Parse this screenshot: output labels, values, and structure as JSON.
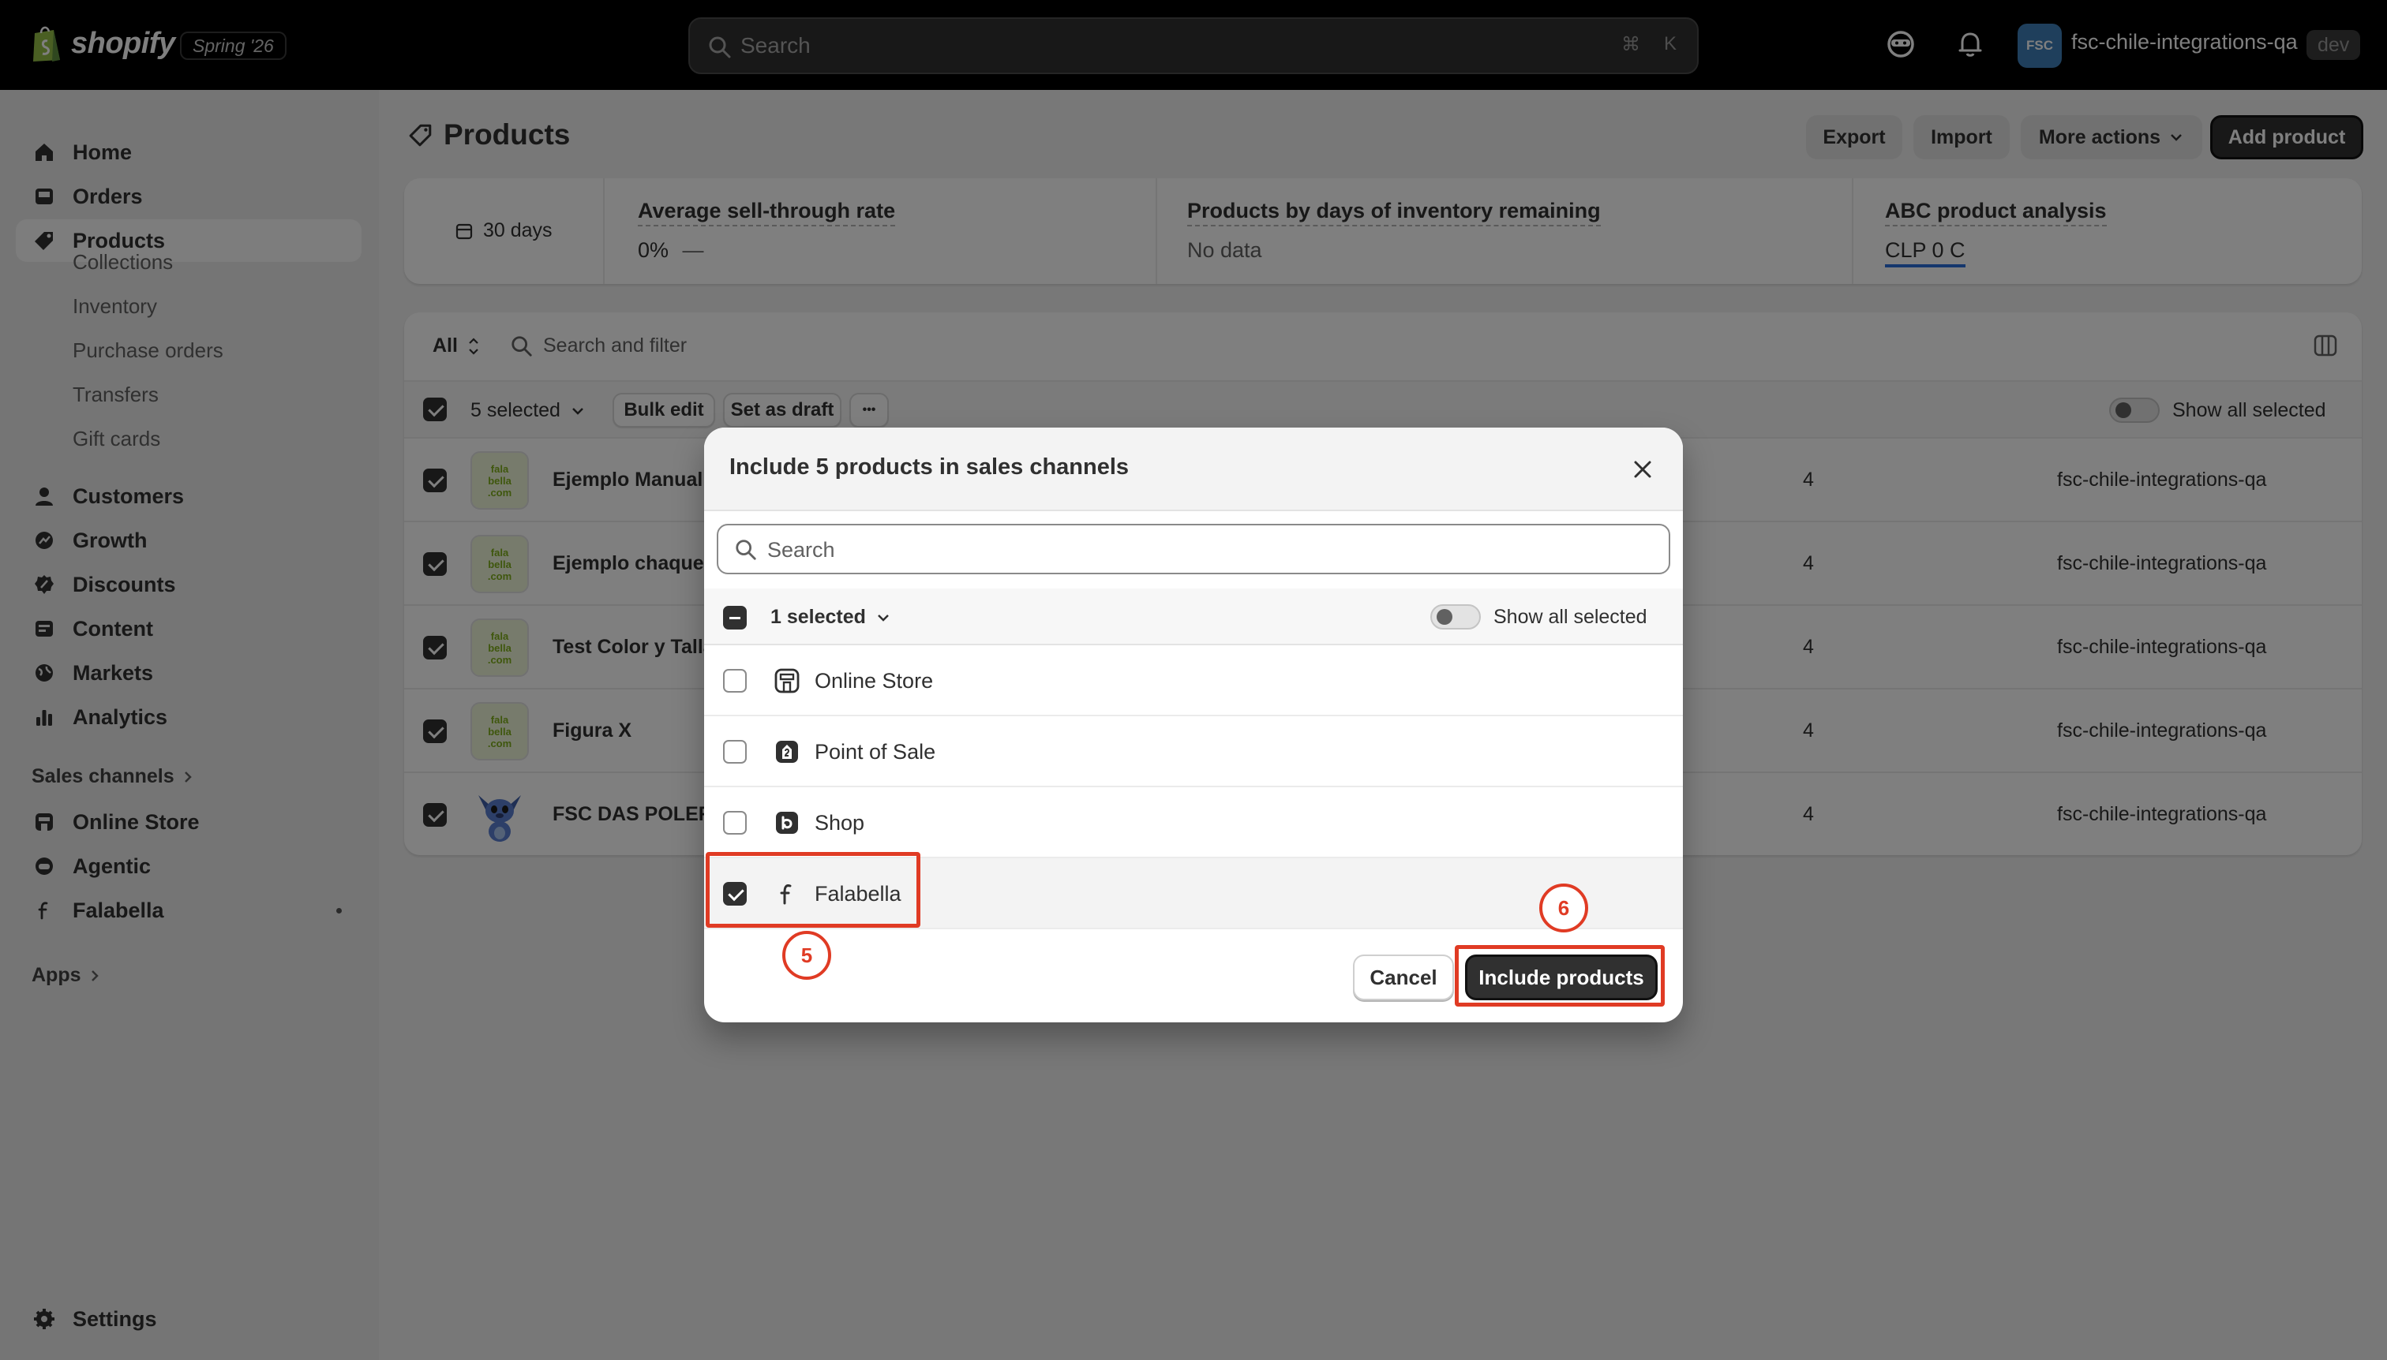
{
  "topbar": {
    "logo_text": "shopify",
    "release_badge": "Spring '26",
    "search_placeholder": "Search",
    "shortcut_cmd": "⌘",
    "shortcut_key": "K",
    "store_initials": "FSC",
    "store_name": "fsc-chile-integrations-qa",
    "env_badge": "dev"
  },
  "sidebar": {
    "items": [
      {
        "label": "Home",
        "icon": "home-icon"
      },
      {
        "label": "Orders",
        "icon": "inbox-icon"
      },
      {
        "label": "Products",
        "icon": "tag-icon",
        "active": true
      },
      {
        "label": "Customers",
        "icon": "person-icon"
      },
      {
        "label": "Growth",
        "icon": "growth-icon"
      },
      {
        "label": "Discounts",
        "icon": "discount-icon"
      },
      {
        "label": "Content",
        "icon": "content-icon"
      },
      {
        "label": "Markets",
        "icon": "globe-icon"
      },
      {
        "label": "Analytics",
        "icon": "bar-chart-icon"
      }
    ],
    "product_subitems": [
      "Collections",
      "Inventory",
      "Purchase orders",
      "Transfers",
      "Gift cards"
    ],
    "sales_channels_label": "Sales channels",
    "channels": [
      {
        "label": "Online Store",
        "icon": "store-icon"
      },
      {
        "label": "Agentic",
        "icon": "agent-icon"
      },
      {
        "label": "Falabella",
        "icon": "falabella-icon"
      }
    ],
    "apps_label": "Apps",
    "settings_label": "Settings"
  },
  "page": {
    "title": "Products",
    "actions": {
      "export": "Export",
      "import": "Import",
      "more": "More actions",
      "add": "Add product"
    }
  },
  "analytics": {
    "period": "30 days",
    "cards": [
      {
        "title": "Average sell-through rate",
        "value": "0%",
        "trend": "—"
      },
      {
        "title": "Products by days of inventory remaining",
        "value": "No data"
      },
      {
        "title": "ABC product analysis",
        "value": "CLP 0 C"
      }
    ]
  },
  "table": {
    "filter_tab": "All",
    "search_placeholder": "Search and filter",
    "selected_count": "5 selected",
    "bulk_edit": "Bulk edit",
    "set_draft": "Set as draft",
    "more": "•••",
    "show_all_selected": "Show all selected",
    "rows": [
      {
        "name": "Ejemplo Manual",
        "inventory": "4",
        "vendor": "fsc-chile-integrations-qa",
        "thumb": "falabella"
      },
      {
        "name": "Ejemplo chaquet",
        "inventory": "4",
        "vendor": "fsc-chile-integrations-qa",
        "thumb": "falabella"
      },
      {
        "name": "Test Color y Talla",
        "inventory": "4",
        "vendor": "fsc-chile-integrations-qa",
        "thumb": "falabella"
      },
      {
        "name": "Figura X",
        "inventory": "4",
        "vendor": "fsc-chile-integrations-qa",
        "thumb": "falabella"
      },
      {
        "name": "FSC DAS POLERA",
        "inventory": "4",
        "vendor": "fsc-chile-integrations-qa",
        "thumb": "stitch"
      }
    ],
    "thumb_text": [
      "fala",
      "bella",
      ".com"
    ]
  },
  "modal": {
    "title": "Include 5 products in sales channels",
    "search_placeholder": "Search",
    "selected_count": "1 selected",
    "show_all_selected": "Show all selected",
    "channels": [
      {
        "label": "Online Store",
        "icon": "store-icon",
        "checked": false
      },
      {
        "label": "Point of Sale",
        "icon": "pos-icon",
        "checked": false
      },
      {
        "label": "Shop",
        "icon": "shop-icon",
        "checked": false
      },
      {
        "label": "Falabella",
        "icon": "falabella-icon",
        "checked": true
      }
    ],
    "cancel": "Cancel",
    "include": "Include products"
  },
  "annotations": {
    "step_5": "5",
    "step_6": "6",
    "color": "#e03b24"
  }
}
